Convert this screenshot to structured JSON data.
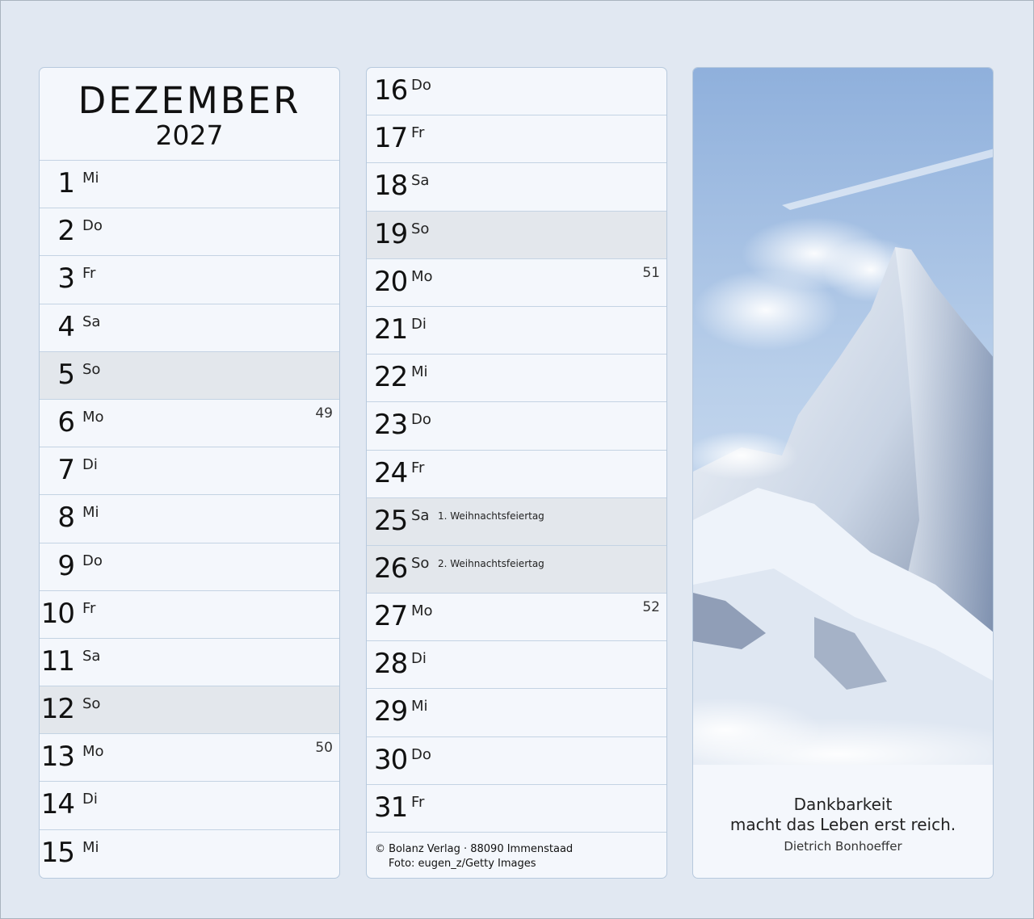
{
  "header": {
    "month": "DEZEMBER",
    "year": "2027"
  },
  "days_left": [
    {
      "day": "1",
      "wd": "Mi",
      "sunday": false,
      "kw": ""
    },
    {
      "day": "2",
      "wd": "Do",
      "sunday": false,
      "kw": ""
    },
    {
      "day": "3",
      "wd": "Fr",
      "sunday": false,
      "kw": ""
    },
    {
      "day": "4",
      "wd": "Sa",
      "sunday": false,
      "kw": ""
    },
    {
      "day": "5",
      "wd": "So",
      "sunday": true,
      "kw": ""
    },
    {
      "day": "6",
      "wd": "Mo",
      "sunday": false,
      "kw": "49"
    },
    {
      "day": "7",
      "wd": "Di",
      "sunday": false,
      "kw": ""
    },
    {
      "day": "8",
      "wd": "Mi",
      "sunday": false,
      "kw": ""
    },
    {
      "day": "9",
      "wd": "Do",
      "sunday": false,
      "kw": ""
    },
    {
      "day": "10",
      "wd": "Fr",
      "sunday": false,
      "kw": ""
    },
    {
      "day": "11",
      "wd": "Sa",
      "sunday": false,
      "kw": ""
    },
    {
      "day": "12",
      "wd": "So",
      "sunday": true,
      "kw": ""
    },
    {
      "day": "13",
      "wd": "Mo",
      "sunday": false,
      "kw": "50"
    },
    {
      "day": "14",
      "wd": "Di",
      "sunday": false,
      "kw": ""
    },
    {
      "day": "15",
      "wd": "Mi",
      "sunday": false,
      "kw": ""
    }
  ],
  "days_mid": [
    {
      "day": "16",
      "wd": "Do",
      "sunday": false,
      "kw": "",
      "holiday": ""
    },
    {
      "day": "17",
      "wd": "Fr",
      "sunday": false,
      "kw": "",
      "holiday": ""
    },
    {
      "day": "18",
      "wd": "Sa",
      "sunday": false,
      "kw": "",
      "holiday": ""
    },
    {
      "day": "19",
      "wd": "So",
      "sunday": true,
      "kw": "",
      "holiday": ""
    },
    {
      "day": "20",
      "wd": "Mo",
      "sunday": false,
      "kw": "51",
      "holiday": ""
    },
    {
      "day": "21",
      "wd": "Di",
      "sunday": false,
      "kw": "",
      "holiday": ""
    },
    {
      "day": "22",
      "wd": "Mi",
      "sunday": false,
      "kw": "",
      "holiday": ""
    },
    {
      "day": "23",
      "wd": "Do",
      "sunday": false,
      "kw": "",
      "holiday": ""
    },
    {
      "day": "24",
      "wd": "Fr",
      "sunday": false,
      "kw": "",
      "holiday": ""
    },
    {
      "day": "25",
      "wd": "Sa",
      "sunday": true,
      "kw": "",
      "holiday": "1. Weihnachtsfeiertag"
    },
    {
      "day": "26",
      "wd": "So",
      "sunday": true,
      "kw": "",
      "holiday": "2. Weihnachtsfeiertag"
    },
    {
      "day": "27",
      "wd": "Mo",
      "sunday": false,
      "kw": "52",
      "holiday": ""
    },
    {
      "day": "28",
      "wd": "Di",
      "sunday": false,
      "kw": "",
      "holiday": ""
    },
    {
      "day": "29",
      "wd": "Mi",
      "sunday": false,
      "kw": "",
      "holiday": ""
    },
    {
      "day": "30",
      "wd": "Do",
      "sunday": false,
      "kw": "",
      "holiday": ""
    },
    {
      "day": "31",
      "wd": "Fr",
      "sunday": false,
      "kw": "",
      "holiday": ""
    }
  ],
  "credits": {
    "line1": "© Bolanz Verlag · 88090 Immenstaad",
    "line2": "Foto: eugen_z/Getty Images"
  },
  "quote": {
    "line1": "Dankbarkeit",
    "line2": "macht das Leben erst reich.",
    "author": "Dietrich Bonhoeffer"
  },
  "colors": {
    "background": "#e1e8f2",
    "panel": "#f4f7fc",
    "sunday_row": "#e3e7ec",
    "divider": "#c4d3e3"
  },
  "photo": {
    "subject": "snowy-mountain-peak"
  }
}
